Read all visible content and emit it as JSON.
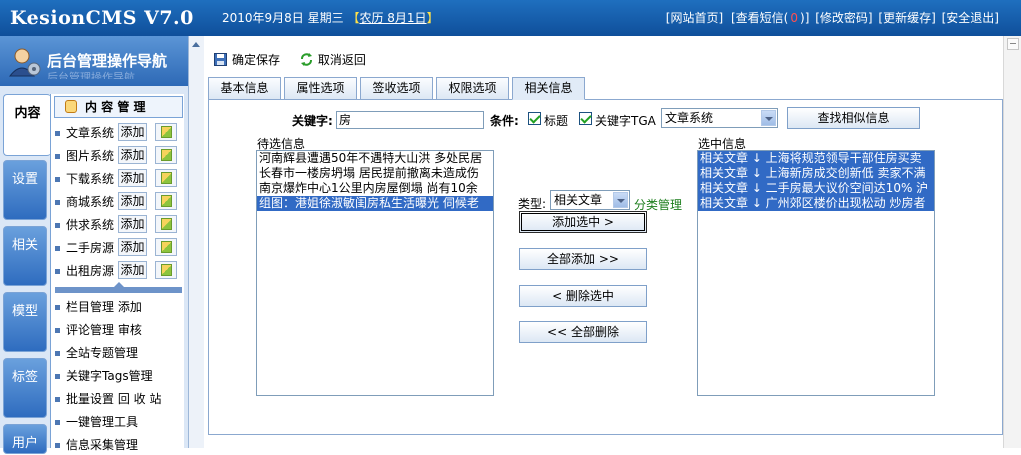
{
  "header": {
    "app_title": "KesionCMS V7.0",
    "date": "2010年9月8日 星期三",
    "lunar_open": "【",
    "lunar": "农历 8月1日",
    "lunar_close": "】",
    "links": [
      {
        "label": "[网站首页]"
      },
      {
        "label": "[查看短信(",
        "badge": "0",
        "suffix": ")]"
      },
      {
        "label": "[修改密码]"
      },
      {
        "label": "[更新缓存]"
      },
      {
        "label": "[安全退出]"
      }
    ]
  },
  "sidebar": {
    "title": "后台管理操作导航",
    "title_ghost": "后台管理操作导航",
    "vtabs": [
      "内容",
      "设置",
      "相关",
      "模型",
      "标签",
      "用户"
    ],
    "panel_title": "内 容 管 理",
    "add_label": "添加",
    "systems": [
      "文章系统",
      "图片系统",
      "下载系统",
      "商城系统",
      "供求系统",
      "二手房源",
      "出租房源"
    ],
    "extra_items": [
      "栏目管理 添加",
      "评论管理 审核",
      "全站专题管理",
      "关键字Tags管理",
      "批量设置 回 收 站",
      "一键管理工具",
      "信息采集管理"
    ]
  },
  "toolbar": {
    "save": "确定保存",
    "back": "取消返回"
  },
  "tabs": [
    "基本信息",
    "属性选项",
    "签收选项",
    "权限选项",
    "相关信息"
  ],
  "active_tab": 4,
  "related": {
    "keyword_label": "关键字:",
    "keyword_value": "房",
    "condition_label": "条件:",
    "title_checkbox": "标题",
    "tag_checkbox": "关键字TGA",
    "system_select": "文章系统",
    "search_button": "查找相似信息",
    "candidates_label": "待选信息",
    "candidates": [
      "河南辉县遭遇50年不遇特大山洪 多处民居",
      "长春市一楼房坍塌 居民提前撤离未造成伤",
      "南京爆炸中心1公里内房屋倒塌 尚有10余",
      "组图：港姐徐淑敏闺房私生活曝光 伺候老"
    ],
    "candidates_selected": 3,
    "type_label": "类型:",
    "type_select": "相关文章",
    "category_manage": "分类管理",
    "add_selected": "添加选中 >",
    "add_all": "全部添加 >>",
    "delete_selected": "< 删除选中",
    "delete_all": "<< 全部删除",
    "selected_label": "选中信息",
    "selected": [
      "相关文章 ↓ 上海将规范领导干部住房买卖",
      "相关文章 ↓ 上海新房成交创新低 卖家不满",
      "相关文章 ↓ 二手房最大议价空间达10% 沪",
      "相关文章 ↓ 广州郊区楼价出现松动 炒房者"
    ]
  }
}
